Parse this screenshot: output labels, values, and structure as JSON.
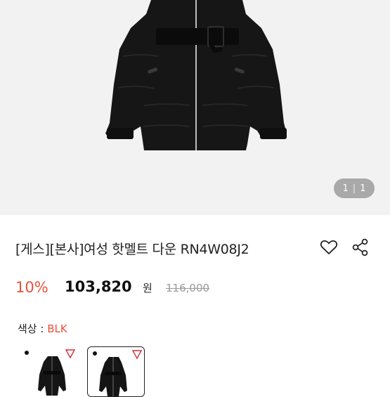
{
  "gallery": {
    "current": "1",
    "total": "1"
  },
  "product": {
    "title": "[게스][본사]여성 핫멜트 다운 RN4W08J2",
    "discount": "10%",
    "price": "103,820",
    "currency": "원",
    "original_price": "116,000"
  },
  "color": {
    "label": "색상 : ",
    "value": "BLK"
  },
  "colors": {
    "accent": "#e8503a",
    "text": "#222222",
    "muted": "#9a9a9a",
    "jacket": "#141414"
  },
  "icons": [
    "heart-icon",
    "share-icon",
    "guess-logo-icon",
    "dot-icon"
  ]
}
